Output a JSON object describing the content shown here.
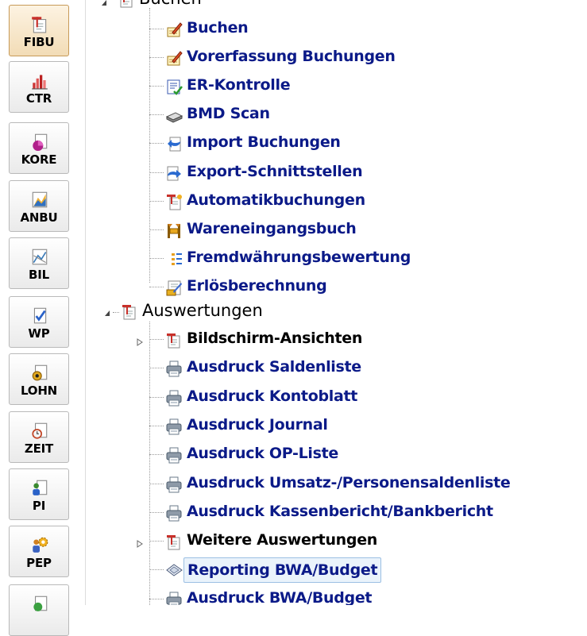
{
  "sidebar": {
    "modules": [
      {
        "label": "FIBU",
        "icon": "document-pin-icon",
        "active": true
      },
      {
        "label": "CTR",
        "icon": "bar-chart-icon"
      },
      {
        "label": "KORE",
        "icon": "document-pie-icon"
      },
      {
        "label": "ANBU",
        "icon": "asset-chart-icon"
      },
      {
        "label": "BIL",
        "icon": "balance-chart-icon"
      },
      {
        "label": "WP",
        "icon": "document-check-icon"
      },
      {
        "label": "LOHN",
        "icon": "document-coins-icon"
      },
      {
        "label": "ZEIT",
        "icon": "document-clock-icon"
      },
      {
        "label": "PI",
        "icon": "document-person-icon"
      },
      {
        "label": "PEP",
        "icon": "people-gear-icon"
      },
      {
        "label": "",
        "icon": "document-green-icon"
      }
    ]
  },
  "tree": {
    "buchen_group": {
      "label": "Buchen",
      "icon": "document-pin-icon"
    },
    "buchen_items": [
      {
        "label": "Buchen",
        "icon": "pen-ledger-icon"
      },
      {
        "label": "Vorerfassung Buchungen",
        "icon": "pen-ledger-icon"
      },
      {
        "label": "ER-Kontrolle",
        "icon": "list-check-icon"
      },
      {
        "label": "BMD Scan",
        "icon": "scanner-icon"
      },
      {
        "label": "Import Buchungen",
        "icon": "import-arrow-icon"
      },
      {
        "label": "Export-Schnittstellen",
        "icon": "export-arrow-icon"
      },
      {
        "label": "Automatikbuchungen",
        "icon": "auto-document-icon"
      },
      {
        "label": "Wareneingangsbuch",
        "icon": "goods-book-icon"
      },
      {
        "label": "Fremdwährungsbewertung",
        "icon": "currency-list-icon"
      },
      {
        "label": "Erlösberechnung",
        "icon": "revenue-note-icon"
      }
    ],
    "auswertungen_group": {
      "label": "Auswertungen",
      "icon": "document-pin-icon"
    },
    "auswertungen_items": [
      {
        "label": "Bildschirm-Ansichten",
        "icon": "document-pin-icon",
        "type": "folder"
      },
      {
        "label": "Ausdruck Saldenliste",
        "icon": "printer-icon"
      },
      {
        "label": "Ausdruck Kontoblatt",
        "icon": "printer-icon"
      },
      {
        "label": "Ausdruck Journal",
        "icon": "printer-icon"
      },
      {
        "label": "Ausdruck OP-Liste",
        "icon": "printer-icon"
      },
      {
        "label": "Ausdruck Umsatz-/Personensaldenliste",
        "icon": "printer-icon"
      },
      {
        "label": "Ausdruck Kassenbericht/Bankbericht",
        "icon": "printer-icon"
      },
      {
        "label": "Weitere Auswertungen",
        "icon": "document-pin-icon",
        "type": "folder"
      },
      {
        "label": "Reporting BWA/Budget",
        "icon": "report-diamond-icon",
        "selected": true
      },
      {
        "label": "Ausdruck BWA/Budget",
        "icon": "printer-icon"
      }
    ]
  },
  "colors": {
    "leaf_text": "#0b1a88",
    "folder_text": "#000000",
    "active_module_bg": "#f2dcb6",
    "selection_bg": "#eaf3fb",
    "selection_border": "#9cc0e3"
  }
}
